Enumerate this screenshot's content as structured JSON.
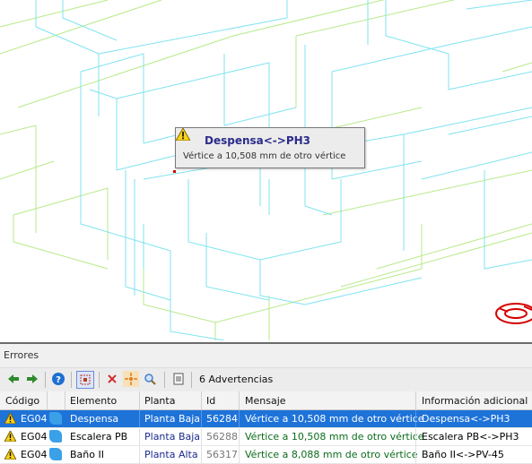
{
  "tooltip": {
    "title": "Despensa<->PH3",
    "message": "Vértice a 10,508 mm de otro vértice"
  },
  "panel": {
    "title": "Errores",
    "count_label": "6 Advertencias"
  },
  "columns": {
    "codigo": "Código",
    "elemento": "Elemento",
    "planta": "Planta",
    "id": "Id",
    "mensaje": "Mensaje",
    "info": "Información adicional"
  },
  "rows": [
    {
      "code": "EG04",
      "element": "Despensa",
      "planta": "Planta Baja",
      "id": "56284",
      "message": "Vértice a 10,508 mm de otro vértice",
      "info": "Despensa<->PH3"
    },
    {
      "code": "EG04",
      "element": "Escalera PB",
      "planta": "Planta Baja",
      "id": "56288",
      "message": "Vértice a 10,508 mm de otro vértice",
      "info": "Escalera PB<->PH3"
    },
    {
      "code": "EG04",
      "element": "Baño II",
      "planta": "Planta Alta",
      "id": "56317",
      "message": "Vértice a 8,088 mm de otro vértice",
      "info": "Baño II<->PV-45"
    }
  ],
  "colors": {
    "selection": "#1e73d9",
    "wire_cyan": "#7fe3f0",
    "wire_green": "#b7ea8a",
    "marker_red": "#d40000"
  }
}
